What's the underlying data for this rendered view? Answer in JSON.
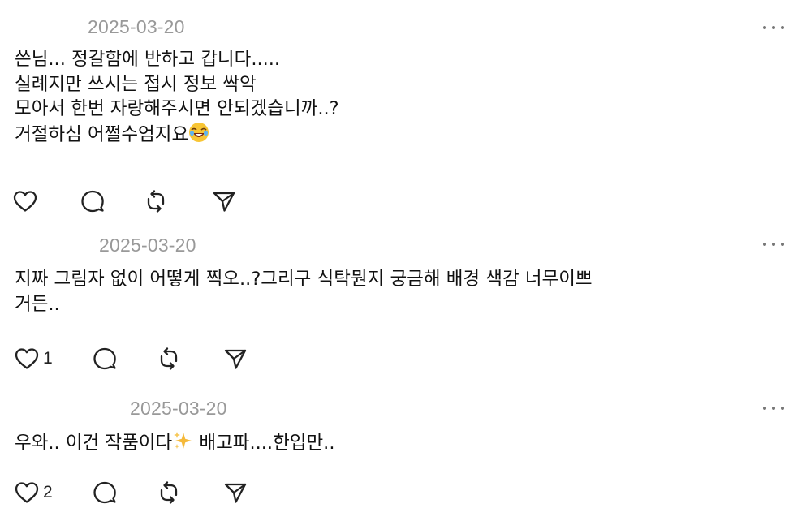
{
  "posts": [
    {
      "date": "2025-03-20",
      "lines": [
        "쓴님... 정갈함에 반하고 갑니다.....",
        "실례지만 쓰시는 접시 정보 싹악",
        "모아서 한번 자랑해주시면 안되겠습니까..?",
        "거절하심 어쩔수엄지요"
      ],
      "emoji": "laughing-face-emoji",
      "like_count": ""
    },
    {
      "date": "2025-03-20",
      "lines": [
        "지짜 그림자 없이 어떻게 찍오..?그리구 식탁뭔지 궁금해 배경 색감 너무이쁘",
        "거든.."
      ],
      "like_count": "1"
    },
    {
      "date": "2025-03-20",
      "line_before": "우와.. 이건 작품이다",
      "emoji": "sparkles-emoji",
      "line_after": " 배고파....한입만..",
      "like_count": "2"
    }
  ],
  "icons": {
    "like": "heart-icon",
    "reply": "comment-icon",
    "repost": "repost-icon",
    "share": "send-icon",
    "more": "more-dots-icon"
  },
  "colors": {
    "text": "#111111",
    "muted": "#999999",
    "icon": "#222222"
  }
}
